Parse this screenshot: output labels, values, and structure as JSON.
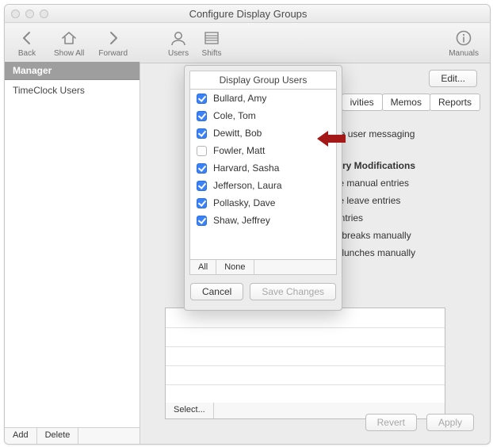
{
  "window": {
    "title": "Configure Display Groups"
  },
  "toolbar": {
    "nav": [
      "Back",
      "Show All",
      "Forward",
      "Users",
      "Shifts",
      "Manuals"
    ]
  },
  "sidebar": {
    "header": "Manager",
    "items": [
      "TimeClock Users"
    ],
    "footer": [
      "Add",
      "Delete"
    ]
  },
  "main": {
    "edit_label": "Edit...",
    "tabs": [
      "ivities",
      "Memos",
      "Reports"
    ],
    "settings_heading": "er Entry Modifications",
    "settings": [
      "Enable user messaging",
      "Create manual entries",
      "Create leave entries",
      "Edit entries",
      "Insert breaks manually",
      "Insert lunches manually"
    ],
    "select_label": "Select...",
    "footer": [
      "Revert",
      "Apply"
    ]
  },
  "dialog": {
    "title": "Display Group Users",
    "users": [
      {
        "name": "Bullard, Amy",
        "checked": true
      },
      {
        "name": "Cole, Tom",
        "checked": true
      },
      {
        "name": "Dewitt, Bob",
        "checked": true
      },
      {
        "name": "Fowler, Matt",
        "checked": false
      },
      {
        "name": "Harvard, Sasha",
        "checked": true
      },
      {
        "name": "Jefferson, Laura",
        "checked": true
      },
      {
        "name": "Pollasky, Dave",
        "checked": true
      },
      {
        "name": "Shaw, Jeffrey",
        "checked": true
      }
    ],
    "toolbar": [
      "All",
      "None"
    ],
    "buttons": [
      "Cancel",
      "Save Changes"
    ]
  }
}
